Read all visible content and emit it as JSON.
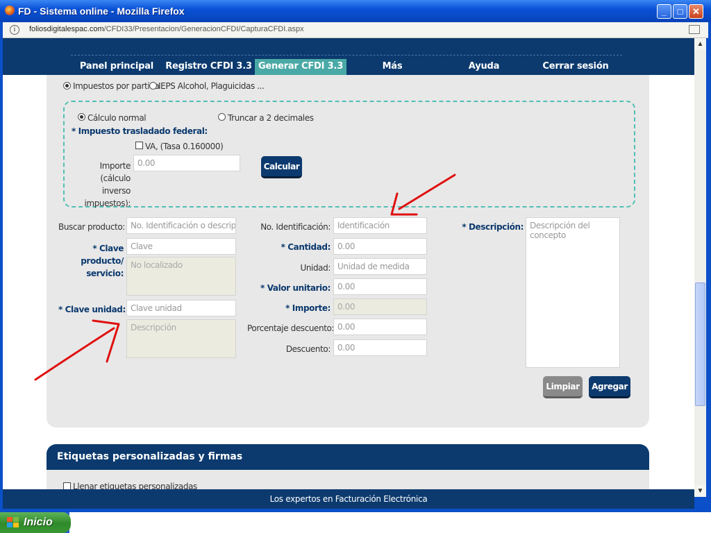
{
  "window": {
    "title": "FD - Sistema online - Mozilla Firefox",
    "url_host": "foliosdigitalespac.com",
    "url_path": "/CFDI33/Presentacion/GeneracionCFDI/CapturaCFDI.aspx"
  },
  "nav": {
    "items": [
      {
        "label": "Panel principal"
      },
      {
        "label": "Registro CFDI 3.3"
      },
      {
        "label": "Generar CFDI 3.3",
        "active": true
      },
      {
        "label": "Más"
      },
      {
        "label": "Ayuda"
      },
      {
        "label": "Cerrar sesión"
      }
    ]
  },
  "taxes": {
    "radio_partida": "Impuestos por partida",
    "radio_ieps": "IEPS Alcohol, Plaguicidas ...",
    "calc_normal": "Cálculo normal",
    "calc_truncar": "Truncar a 2 decimales",
    "federal_label": "* Impuesto trasladado federal:",
    "iva_label": "VA, (Tasa 0.160000)",
    "importe_label": "Importe (cálculo inverso impuestos):",
    "importe_value": "0.00",
    "calcular_button": "Calcular"
  },
  "product": {
    "buscar_label": "Buscar producto:",
    "buscar_placeholder": "No. Identificación o descripción",
    "clave_label": "* Clave producto/ servicio:",
    "clave_placeholder": "Clave",
    "clave_desc": "No localizado",
    "unidad_label": "* Clave unidad:",
    "unidad_placeholder": "Clave unidad",
    "unidad_desc": "Descripción",
    "noid_label": "No. Identificación:",
    "noid_placeholder": "Identificación",
    "cantidad_label": "* Cantidad:",
    "cantidad_value": "0.00",
    "unidad_med_label": "Unidad:",
    "unidad_med_placeholder": "Unidad de medida",
    "valor_label": "* Valor unitario:",
    "valor_value": "0.00",
    "importe_label": "* Importe:",
    "importe_value": "0.00",
    "porc_label": "Porcentaje descuento:",
    "porc_value": "0.00",
    "descuento_label": "Descuento:",
    "descuento_value": "0.00",
    "descripcion_label": "* Descripción:",
    "descripcion_placeholder": "Descripción del concepto",
    "limpiar_button": "Limpiar",
    "agregar_button": "Agregar"
  },
  "section2": {
    "title": "Etiquetas personalizadas y firmas",
    "check_label": "Llenar etiquetas personalizadas"
  },
  "footer": {
    "text": "Los expertos en Facturación Electrónica"
  },
  "taskbar": {
    "start_label": "Inicio"
  },
  "colors": {
    "navy": "#0c3a6e",
    "teal": "#4aa9a6",
    "annotation_red": "#e01010"
  }
}
